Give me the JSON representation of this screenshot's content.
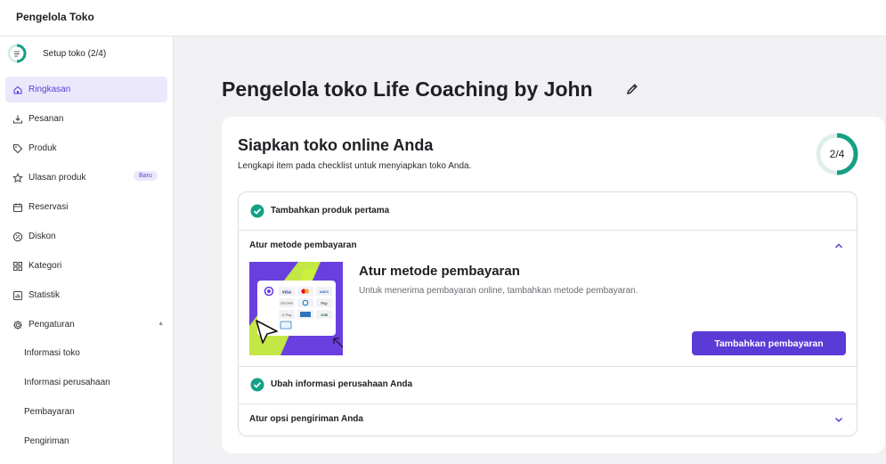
{
  "app": {
    "title": "Pengelola Toko"
  },
  "setup": {
    "label": "Setup toko (2/4)"
  },
  "sidebar": {
    "items": [
      {
        "label": "Ringkasan",
        "icon": "home-icon"
      },
      {
        "label": "Pesanan",
        "icon": "download-tray-icon"
      },
      {
        "label": "Produk",
        "icon": "tag-icon"
      },
      {
        "label": "Ulasan produk",
        "icon": "star-icon",
        "badge": "Baru"
      },
      {
        "label": "Reservasi",
        "icon": "calendar-icon"
      },
      {
        "label": "Diskon",
        "icon": "discount-badge-icon"
      },
      {
        "label": "Kategori",
        "icon": "grid-icon"
      },
      {
        "label": "Statistik",
        "icon": "chart-icon"
      },
      {
        "label": "Pengaturan",
        "icon": "gear-icon",
        "caret": "▲"
      }
    ],
    "subitems": [
      {
        "label": "Informasi toko"
      },
      {
        "label": "Informasi perusahaan"
      },
      {
        "label": "Pembayaran"
      },
      {
        "label": "Pengiriman"
      }
    ]
  },
  "main": {
    "title": "Pengelola toko Life Coaching by John",
    "card": {
      "title": "Siapkan toko online Anda",
      "subtitle": "Lengkapi item pada checklist untuk menyiapkan toko Anda.",
      "progress": {
        "label": "2/4",
        "done": 2,
        "total": 4
      },
      "checklist": [
        {
          "label": "Tambahkan produk pertama",
          "done": true
        },
        {
          "label": "Atur metode pembayaran",
          "done": false,
          "expanded": true,
          "detail_title": "Atur metode pembayaran",
          "detail_desc": "Untuk menerima pembayaran online, tambahkan metode pembayaran.",
          "button": "Tambahkan pembayaran",
          "illustration_brands": [
            "VISA",
            "AMEX",
            "DISCOVER",
            "Pay",
            "G Pay",
            "JCB"
          ]
        },
        {
          "label": "Ubah informasi perusahaan Anda",
          "done": true
        },
        {
          "label": "Atur opsi pengiriman Anda",
          "done": false,
          "expanded": false
        }
      ]
    }
  },
  "colors": {
    "accent": "#5b3bd6",
    "accent_soft": "#ece8fb",
    "success": "#14a085",
    "illus_purple": "#6a3fe0",
    "illus_lime": "#c8f03c"
  }
}
